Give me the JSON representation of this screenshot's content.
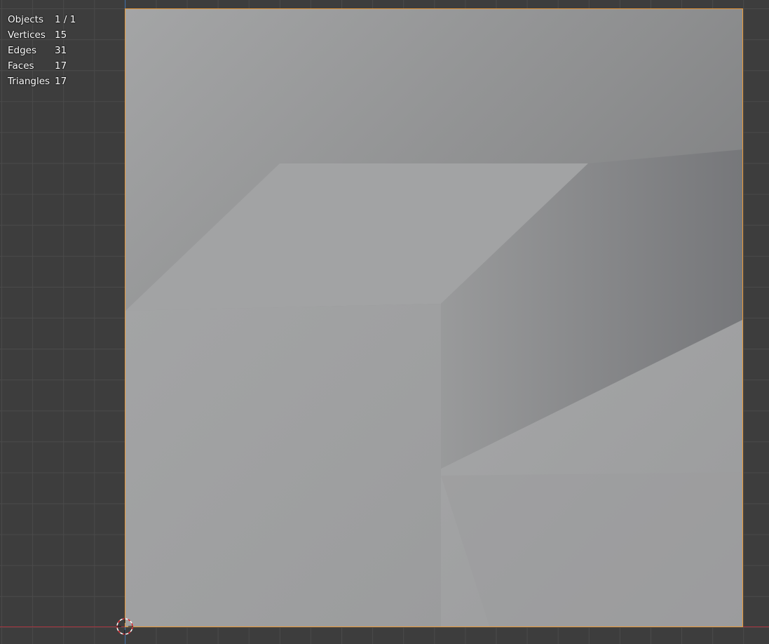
{
  "viewport": {
    "background": "#3d3d3d",
    "grid_color": "#4a4a4a",
    "x_axis_color": "#a8343f",
    "y_axis_color": "#3d6ea8",
    "selection_outline_color": "#e99a3b"
  },
  "stats": [
    {
      "label": "Objects",
      "value": "1 / 1"
    },
    {
      "label": "Vertices",
      "value": "15"
    },
    {
      "label": "Edges",
      "value": "31"
    },
    {
      "label": "Faces",
      "value": "17"
    },
    {
      "label": "Triangles",
      "value": "17"
    }
  ],
  "icons": {
    "cursor": "3d-cursor-icon"
  }
}
